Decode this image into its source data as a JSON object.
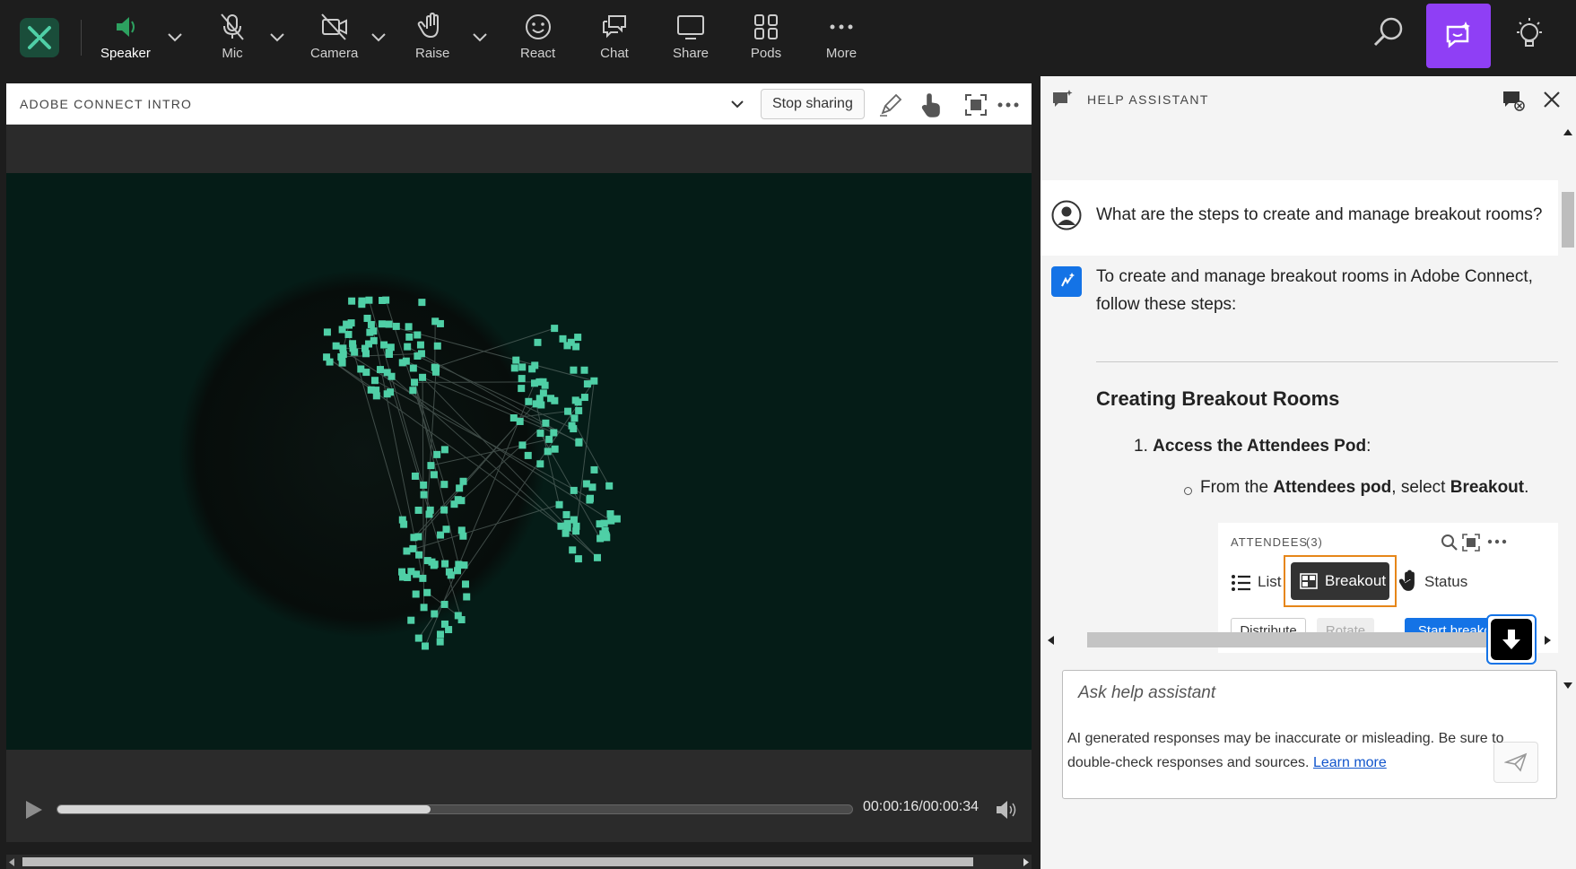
{
  "toolbar": {
    "speaker": "Speaker",
    "mic": "Mic",
    "camera": "Camera",
    "raise": "Raise",
    "react": "React",
    "chat": "Chat",
    "share": "Share",
    "pods": "Pods",
    "more": "More"
  },
  "share_pod": {
    "title": "ADOBE CONNECT INTRO",
    "stop_sharing": "Stop sharing",
    "timecode": "00:00:16/00:00:34",
    "progress_fraction": 0.47
  },
  "help_assistant": {
    "title": "HELP ASSISTANT",
    "user_question": "What are the steps to create and manage breakout rooms?",
    "answer_intro": "To create and manage breakout rooms in Adobe Connect, follow these steps:",
    "section_heading": "Creating Breakout Rooms",
    "step_number": "1.",
    "step_title": "Access the Attendees Pod",
    "step_title_suffix": ":",
    "bullet_prefix": "From the ",
    "bullet_bold1": "Attendees pod",
    "bullet_mid": ", select ",
    "bullet_bold2": "Breakout",
    "bullet_suffix": ".",
    "attendees_screenshot": {
      "header": "ATTENDEES",
      "count": "(3)",
      "list": "List",
      "breakout": "Breakout",
      "status": "Status",
      "distribute": "Distribute",
      "rotate": "Rotate",
      "start_breakout": "Start breakout"
    },
    "ask_placeholder": "Ask help assistant",
    "disclaimer": "AI generated responses may be inaccurate or misleading. Be sure to double-check responses and sources.",
    "learn_more": "Learn more"
  },
  "colors": {
    "accent_purple": "#8f3ff5",
    "accent_blue": "#1473e6",
    "speaker_green": "#2da160",
    "globe_green": "#4fcfa6"
  }
}
